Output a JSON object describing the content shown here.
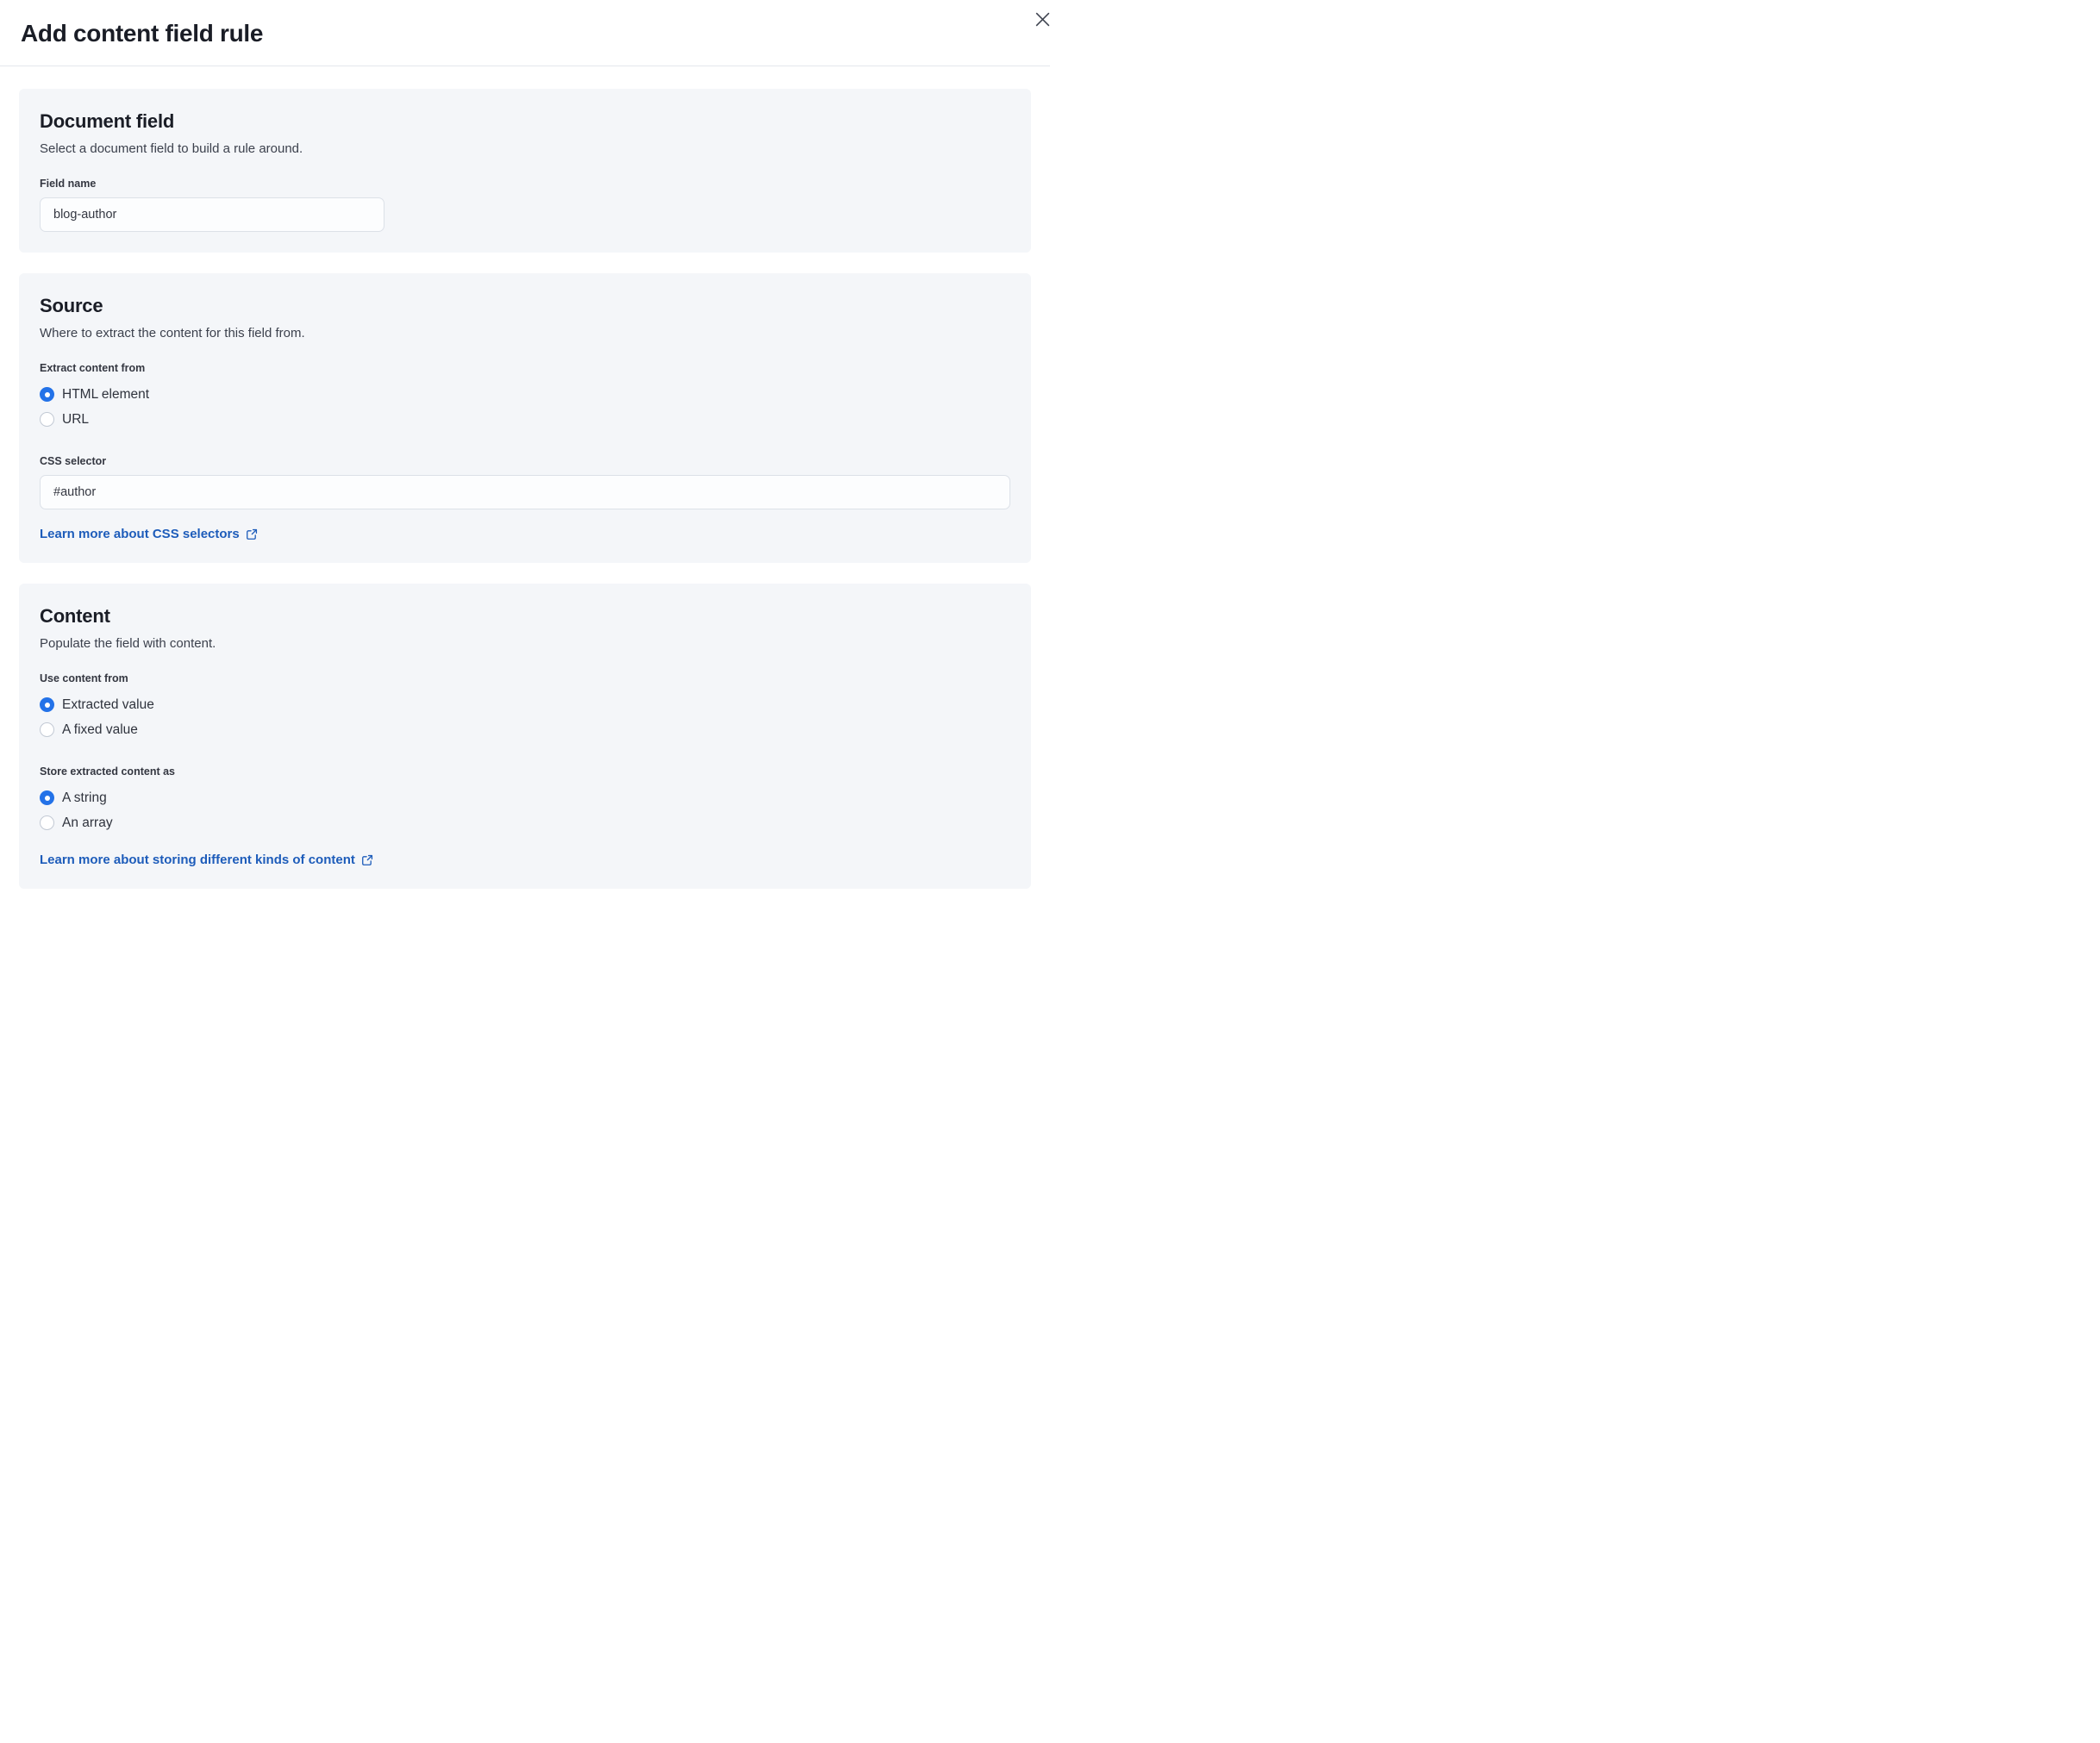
{
  "modal": {
    "title": "Add content field rule",
    "close_icon": "x-close"
  },
  "document_field": {
    "heading": "Document field",
    "description": "Select a document field to build a rule around.",
    "field_name_label": "Field name",
    "field_name_value": "blog-author"
  },
  "source": {
    "heading": "Source",
    "description": "Where to extract the content for this field from.",
    "extract_label": "Extract content from",
    "extract_options": [
      {
        "label": "HTML element",
        "selected": true
      },
      {
        "label": "URL",
        "selected": false
      }
    ],
    "css_selector_label": "CSS selector",
    "css_selector_value": "#author",
    "learn_more_label": "Learn more about CSS selectors"
  },
  "content": {
    "heading": "Content",
    "description": "Populate the field with content.",
    "use_content_label": "Use content from",
    "use_content_options": [
      {
        "label": "Extracted value",
        "selected": true
      },
      {
        "label": "A fixed value",
        "selected": false
      }
    ],
    "store_label": "Store extracted content as",
    "store_options": [
      {
        "label": "A string",
        "selected": true
      },
      {
        "label": "An array",
        "selected": false
      }
    ],
    "learn_more_label": "Learn more about storing different kinds of content"
  },
  "colors": {
    "accent_blue": "#2372e8",
    "link_blue": "#1d5cba",
    "panel_background": "#f4f6f9",
    "heading_text": "#1a1d26"
  }
}
